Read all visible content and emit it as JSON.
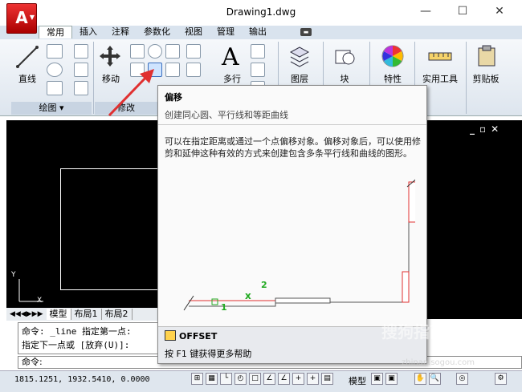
{
  "window": {
    "title": "Drawing1.dwg",
    "minimize": "—",
    "maximize": "☐",
    "close": "✕"
  },
  "app_button": {
    "label": "A"
  },
  "tabs": [
    "常用",
    "插入",
    "注释",
    "参数化",
    "视图",
    "管理",
    "输出"
  ],
  "ribbon": {
    "line": "直线",
    "move": "移动",
    "multiline_text": "多行",
    "text_letter": "A",
    "layer": "图层",
    "block": "块",
    "properties": "特性",
    "utilities": "实用工具",
    "clipboard": "剪贴板",
    "group_draw": "绘图 ▾",
    "group_modify": "修改"
  },
  "tooltip": {
    "title": "偏移",
    "subtitle": "创建同心圆、平行线和等距曲线",
    "description": "可以在指定距离或通过一个点偏移对象。偏移对象后，可以使用修剪和延伸这种有效的方式来创建包含多条平行线和曲线的图形。",
    "label1": "1",
    "label2": "2",
    "command": "OFFSET",
    "help": "按 F1 键获得更多帮助"
  },
  "layout_tabs": [
    "模型",
    "布局1",
    "布局2"
  ],
  "command_line": {
    "line1": "命令: _line 指定第一点:",
    "line2": "指定下一点或 [放弃(U)]:",
    "prompt": "命令:"
  },
  "ucs": {
    "x": "X",
    "y": "Y"
  },
  "status": {
    "coords": "1815.1251, 1932.5410, 0.0000",
    "model": "模型"
  },
  "watermark": {
    "brand": "搜狗指南",
    "url": "zhinan.sogou.com"
  },
  "colors": {
    "accent_red": "#e03030",
    "canvas": "#000000",
    "ribbon_bg": "#dde5ee"
  }
}
